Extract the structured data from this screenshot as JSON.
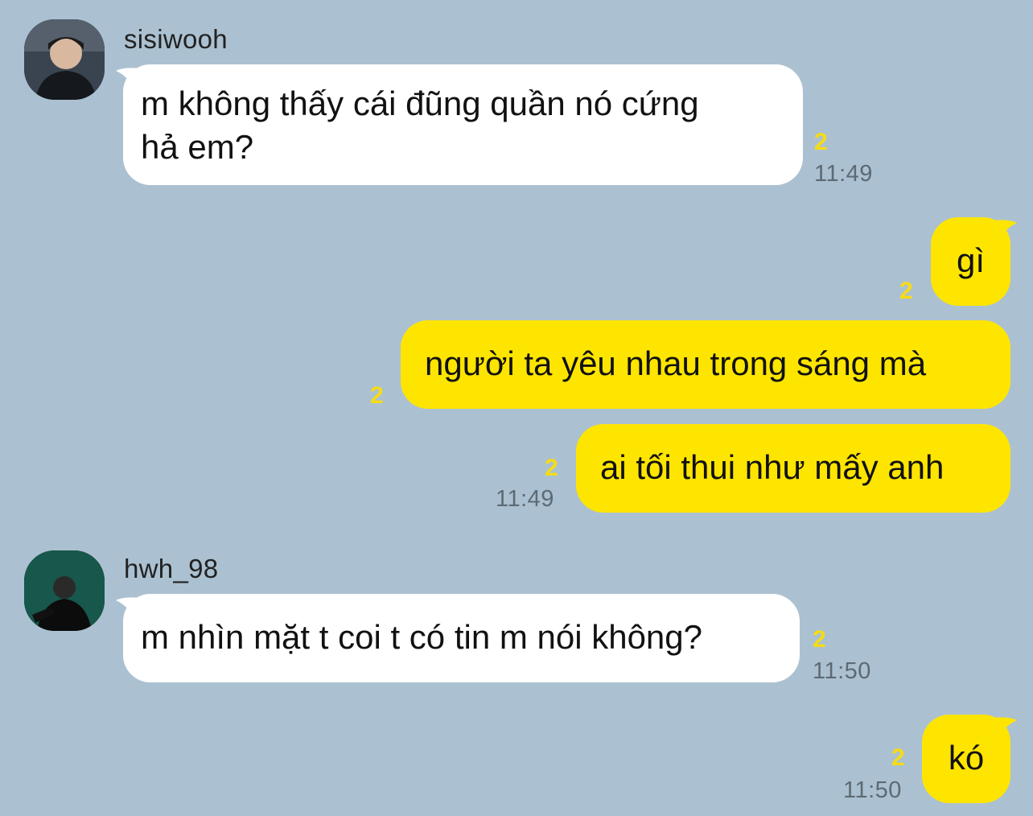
{
  "colors": {
    "background": "#abc1d1",
    "incoming_bubble": "#ffffff",
    "outgoing_bubble": "#fee500",
    "unread": "#f5dc16"
  },
  "messages": [
    {
      "sender": "sisiwooh",
      "avatar_icon": "profile-photo-icon",
      "lines": [
        "m không thấy cái đũng quần nó cứng",
        "hả em?"
      ],
      "unread": "2",
      "time": "11:49"
    },
    {
      "text": "gì",
      "unread": "2"
    },
    {
      "text": "người ta yêu nhau trong sáng mà",
      "unread": "2"
    },
    {
      "text": "ai tối thui như mấy anh",
      "unread": "2",
      "time": "11:49"
    },
    {
      "sender": "hwh_98",
      "avatar_icon": "profile-photo-icon",
      "text": "m nhìn mặt t coi t có tin m nói không?",
      "unread": "2",
      "time": "11:50"
    },
    {
      "text": "kó",
      "unread": "2",
      "time": "11:50"
    }
  ]
}
